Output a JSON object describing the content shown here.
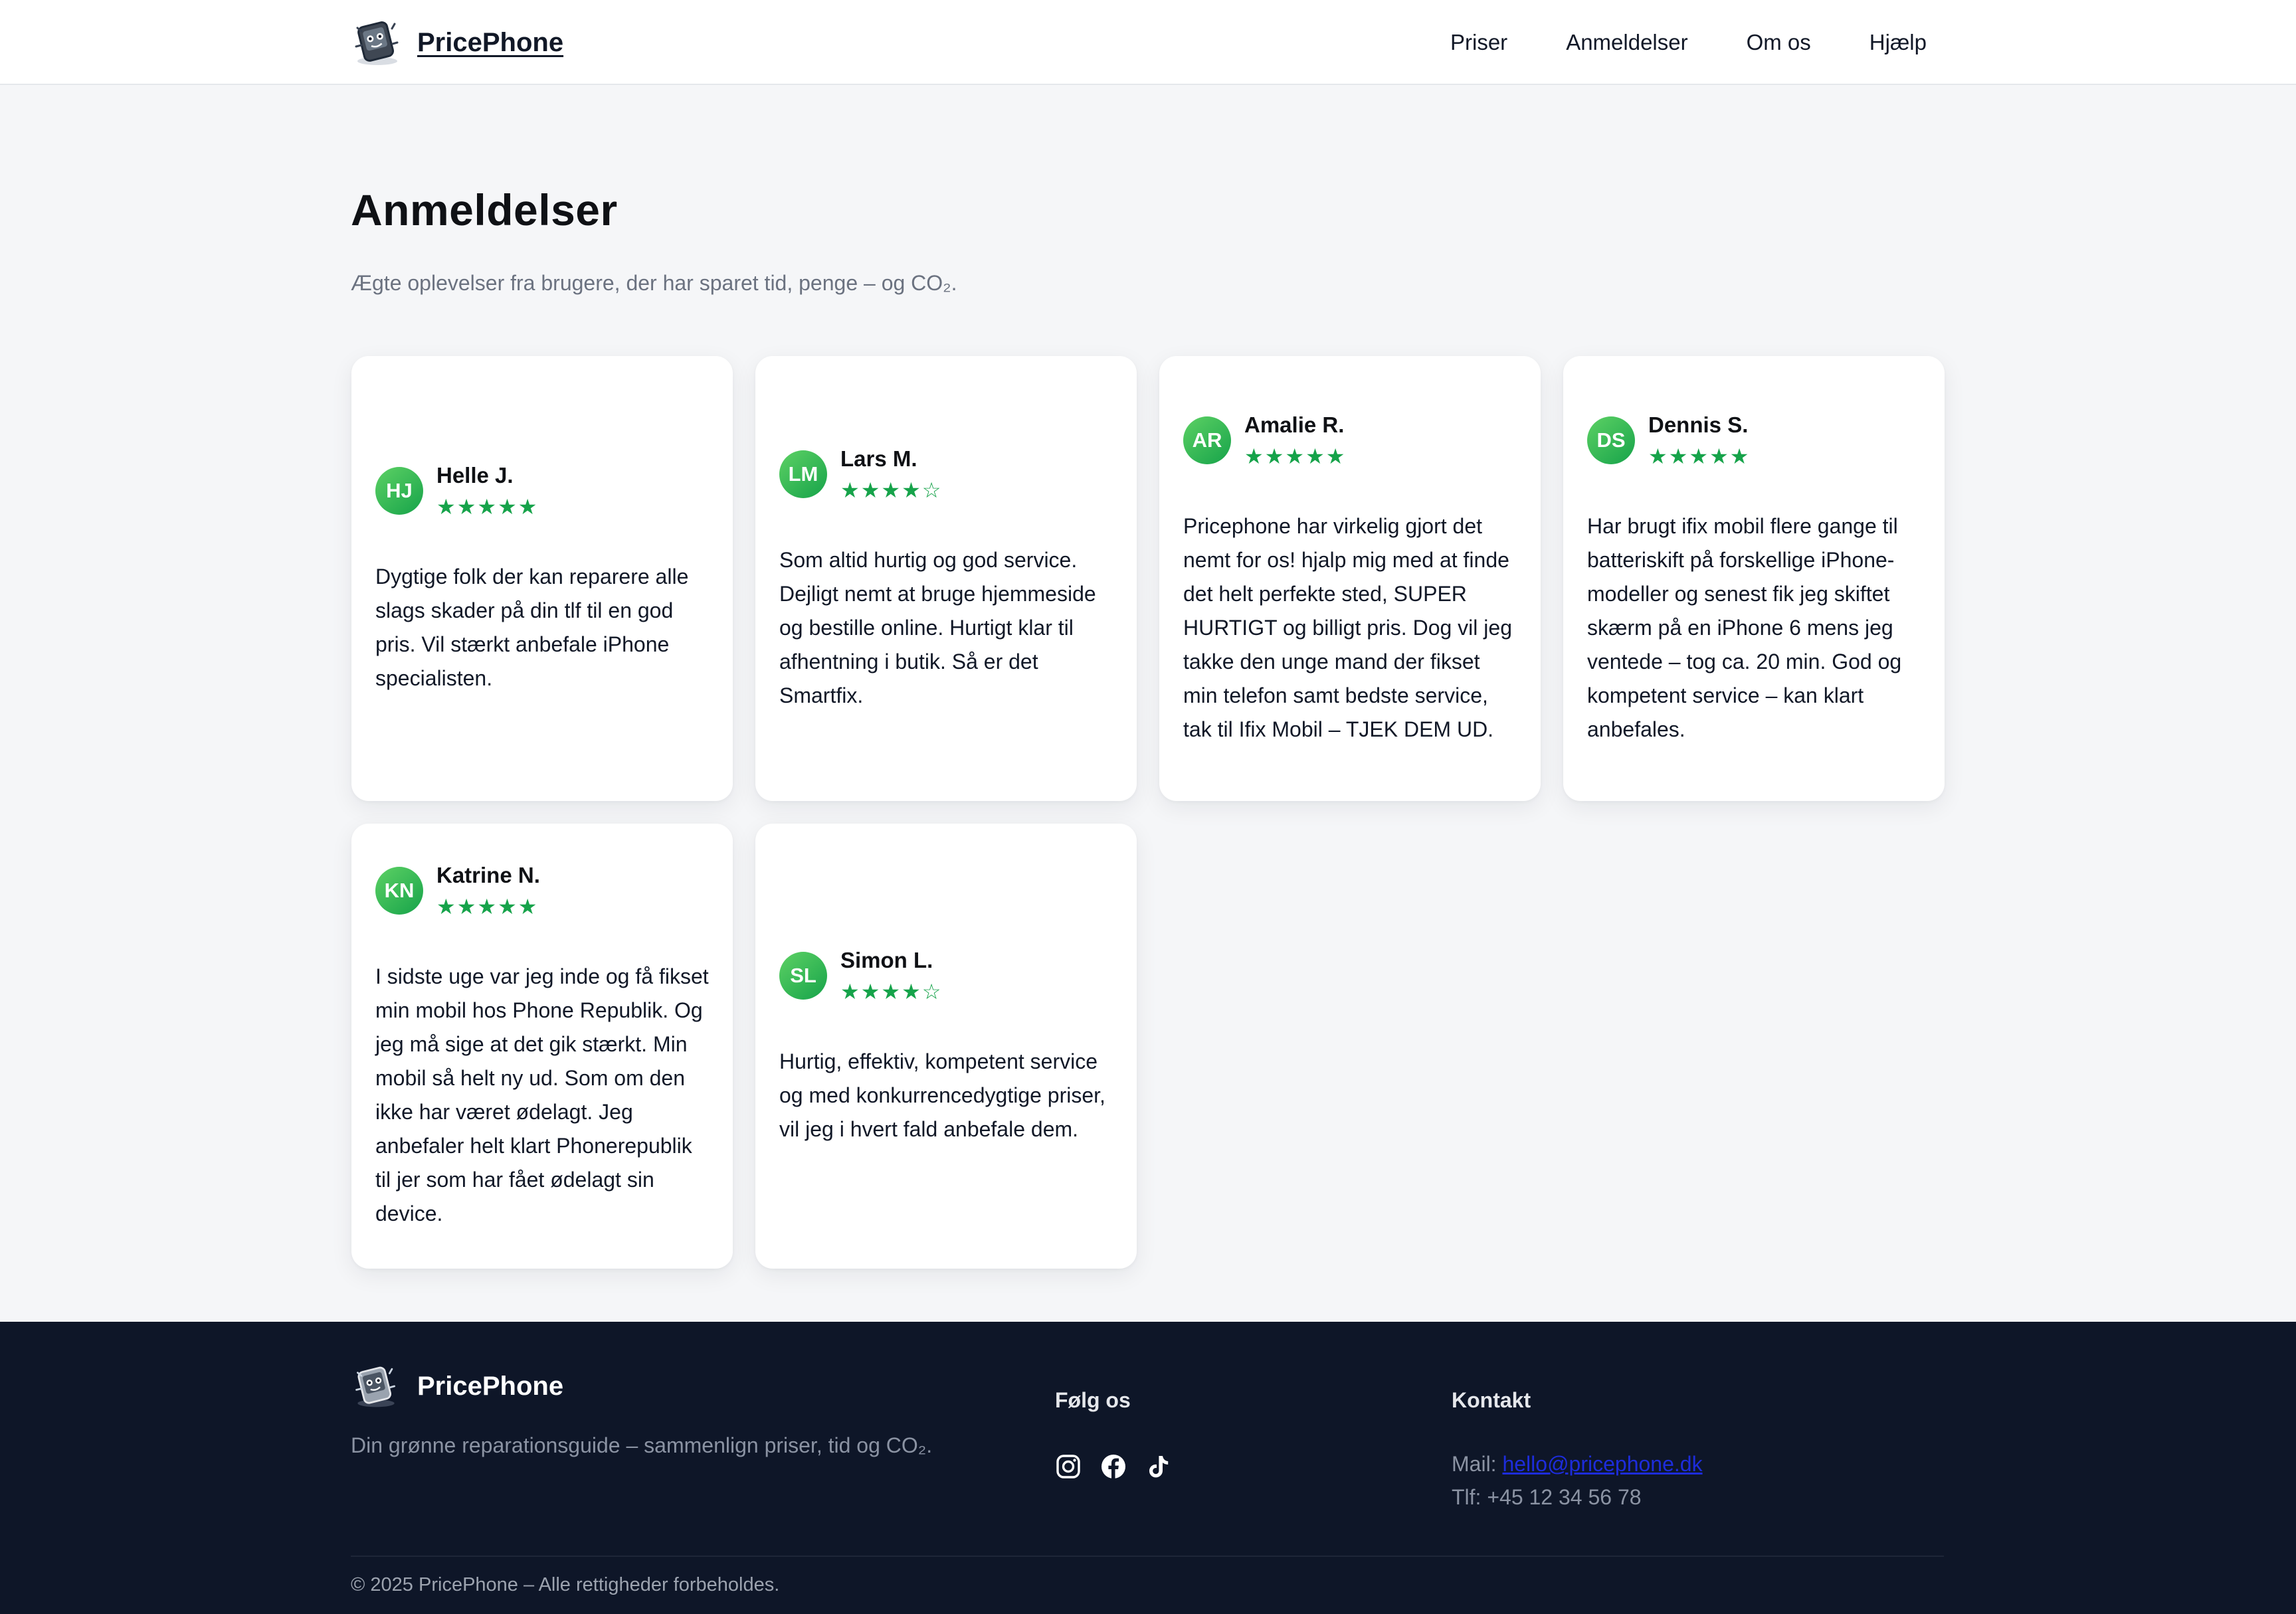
{
  "header": {
    "brand": "PricePhone",
    "nav": [
      "Priser",
      "Anmeldelser",
      "Om os",
      "Hjælp"
    ]
  },
  "main": {
    "title": "Anmeldelser",
    "subtitle": "Ægte oplevelser fra brugere, der har sparet tid, penge – og CO₂.",
    "reviews": [
      {
        "initials": "HJ",
        "name": "Helle J.",
        "stars": "★★★★★",
        "rating": 5,
        "text": "Dygtige folk der kan reparere alle slags skader på din tlf til en god pris. Vil stærkt anbefale iPhone specialisten."
      },
      {
        "initials": "LM",
        "name": "Lars M.",
        "stars": "★★★★☆",
        "rating": 4,
        "text": "Som altid hurtig og god service. Dejligt nemt at bruge hjemmeside og bestille online. Hurtigt klar til afhentning i butik. Så er det Smartfix."
      },
      {
        "initials": "AR",
        "name": "Amalie R.",
        "stars": "★★★★★",
        "rating": 5,
        "text": "Pricephone har virkelig gjort det nemt for os! hjalp mig med at finde det helt perfekte sted, SUPER HURTIGT og billigt pris. Dog vil jeg takke den unge mand der fikset min telefon samt bedste service, tak til Ifix Mobil – TJEK DEM UD."
      },
      {
        "initials": "DS",
        "name": "Dennis S.",
        "stars": "★★★★★",
        "rating": 5,
        "text": "Har brugt ifix mobil flere gange til batteriskift på forskellige iPhone-modeller og senest fik jeg skiftet skærm på en iPhone 6 mens jeg ventede – tog ca. 20 min. God og kompetent service – kan klart anbefales."
      },
      {
        "initials": "KN",
        "name": "Katrine N.",
        "stars": "★★★★★",
        "rating": 5,
        "text": "I sidste uge var jeg inde og få fikset min mobil hos Phone Republik. Og jeg må sige at det gik stærkt. Min mobil så helt ny ud. Som om den ikke har været ødelagt. Jeg anbefaler helt klart Phonerepublik til jer som har fået ødelagt sin device."
      },
      {
        "initials": "SL",
        "name": "Simon L.",
        "stars": "★★★★☆",
        "rating": 4,
        "text": "Hurtig, effektiv, kompetent service og med konkurrencedygtige priser, vil jeg i hvert fald anbefale dem."
      }
    ]
  },
  "footer": {
    "brand": "PricePhone",
    "tagline": "Din grønne reparationsguide – sammenlign priser, tid og CO₂.",
    "follow_heading": "Følg os",
    "socials": [
      "instagram-icon",
      "facebook-icon",
      "tiktok-icon"
    ],
    "contact_heading": "Kontakt",
    "mail_label": "Mail:",
    "mail": "hello@pricephone.dk",
    "phone": "Tlf: +45 12 34 56 78",
    "copyright": "© 2025 PricePhone – Alle rettigheder forbeholdes."
  },
  "colors": {
    "accent_green": "#16a34a",
    "footer_bg": "#0e1628",
    "page_bg": "#f5f6f8",
    "link_blue": "#1d2cdb"
  }
}
